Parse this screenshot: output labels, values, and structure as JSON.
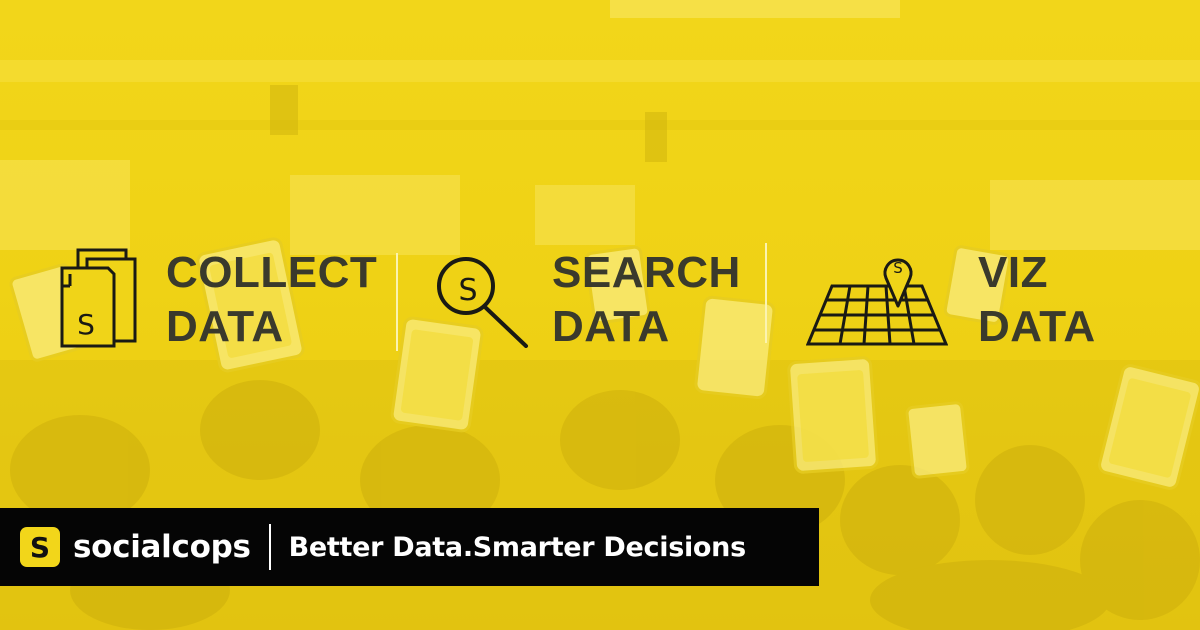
{
  "colors": {
    "accent": "#f2d61a",
    "text": "#3a3a2c",
    "bar": "#050505",
    "bar_text": "#ffffff"
  },
  "features": [
    {
      "icon": "document-s-icon",
      "line1": "COLLECT",
      "line2": "DATA"
    },
    {
      "icon": "search-magnifier-icon",
      "line1": "SEARCH",
      "line2": "DATA"
    },
    {
      "icon": "map-pin-grid-icon",
      "line1": "VIZ",
      "line2": "DATA"
    }
  ],
  "brand": {
    "logo_letter": "S",
    "name": "socialcops",
    "tagline": "Better Data.Smarter Decisions"
  }
}
